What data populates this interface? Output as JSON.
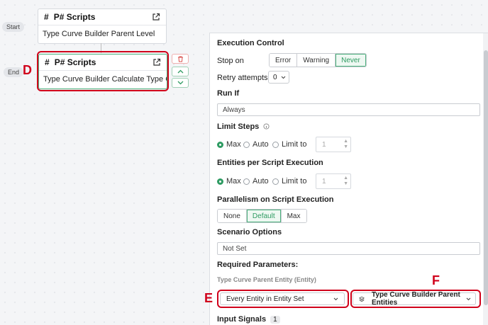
{
  "flow": {
    "start_label": "Start",
    "end_label": "End",
    "nodes": [
      {
        "title": "P# Scripts",
        "subtitle": "Type Curve Builder Parent Level"
      },
      {
        "title": "P# Scripts",
        "subtitle": "Type Curve Builder Calculate Type Curv..."
      }
    ]
  },
  "annotations": {
    "d": "D",
    "e": "E",
    "f": "F"
  },
  "panel": {
    "execution_control": {
      "title": "Execution Control",
      "stop_on_label": "Stop on",
      "stop_on_options": [
        "Error",
        "Warning",
        "Never"
      ],
      "stop_on_selected": "Never",
      "retry_label": "Retry attempts",
      "retry_value": "0"
    },
    "run_if": {
      "title": "Run If",
      "value": "Always"
    },
    "limit_steps": {
      "title": "Limit Steps",
      "opt_max": "Max",
      "opt_auto": "Auto",
      "opt_limit": "Limit to",
      "selected": "Max",
      "limit_value": "1"
    },
    "entities_per_exec": {
      "title": "Entities per Script Execution",
      "opt_max": "Max",
      "opt_auto": "Auto",
      "opt_limit": "Limit to",
      "selected": "Max",
      "limit_value": "1"
    },
    "parallelism": {
      "title": "Parallelism on Script Execution",
      "options": [
        "None",
        "Default",
        "Max"
      ],
      "selected": "Default"
    },
    "scenario": {
      "title": "Scenario Options",
      "value": "Not Set"
    },
    "required_params": {
      "title": "Required Parameters:",
      "param_label": "Type Curve Parent Entity (Entity)",
      "mode_value": "Every Entity in Entity Set",
      "entity_set_value": "Type Curve Builder Parent Entities"
    },
    "input_signals": {
      "title": "Input Signals",
      "count": "1"
    }
  },
  "colors": {
    "accent": "#2e9b62",
    "annotation": "#d0021b"
  }
}
